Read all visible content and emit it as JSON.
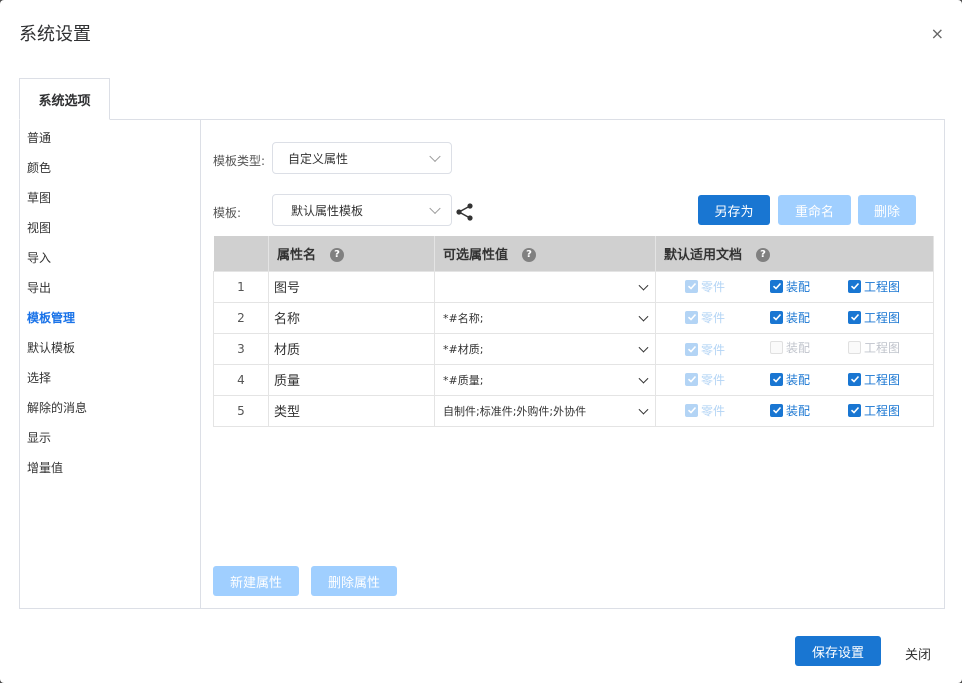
{
  "dialog": {
    "title": "系统设置",
    "close": "×"
  },
  "tab": {
    "label": "系统选项"
  },
  "sidebar": {
    "items": [
      "普通",
      "颜色",
      "草图",
      "视图",
      "导入",
      "导出",
      "模板管理",
      "默认模板",
      "选择",
      "解除的消息",
      "显示",
      "增量值"
    ],
    "active_index": 6
  },
  "form": {
    "template_type_label": "模板类型:",
    "template_type_value": "自定义属性",
    "template_label": "模板:",
    "template_value": "默认属性模板"
  },
  "buttons": {
    "save_as": "另存为",
    "rename": "重命名",
    "delete": "删除",
    "new_attr": "新建属性",
    "delete_attr": "删除属性",
    "save_settings": "保存设置",
    "close": "关闭"
  },
  "table": {
    "headers": {
      "name": "属性名",
      "options": "可选属性值",
      "docs": "默认适用文档",
      "help": "?"
    },
    "doc_labels": {
      "part": "零件",
      "assembly": "装配",
      "drawing": "工程图"
    },
    "rows": [
      {
        "index": "1",
        "name": "图号",
        "options": "",
        "part": true,
        "assembly": true,
        "drawing": true
      },
      {
        "index": "2",
        "name": "名称",
        "options": "*#名称;",
        "part": true,
        "assembly": true,
        "drawing": true
      },
      {
        "index": "3",
        "name": "材质",
        "options": "*#材质;",
        "part": true,
        "assembly": false,
        "drawing": false
      },
      {
        "index": "4",
        "name": "质量",
        "options": "*#质量;",
        "part": true,
        "assembly": true,
        "drawing": true
      },
      {
        "index": "5",
        "name": "类型",
        "options": "自制件;标准件;外购件;外协件",
        "part": true,
        "assembly": true,
        "drawing": true
      }
    ]
  },
  "colors": {
    "primary": "#1976d2",
    "disabled": "#a0cfff",
    "header_bg": "#d0d0d0"
  }
}
